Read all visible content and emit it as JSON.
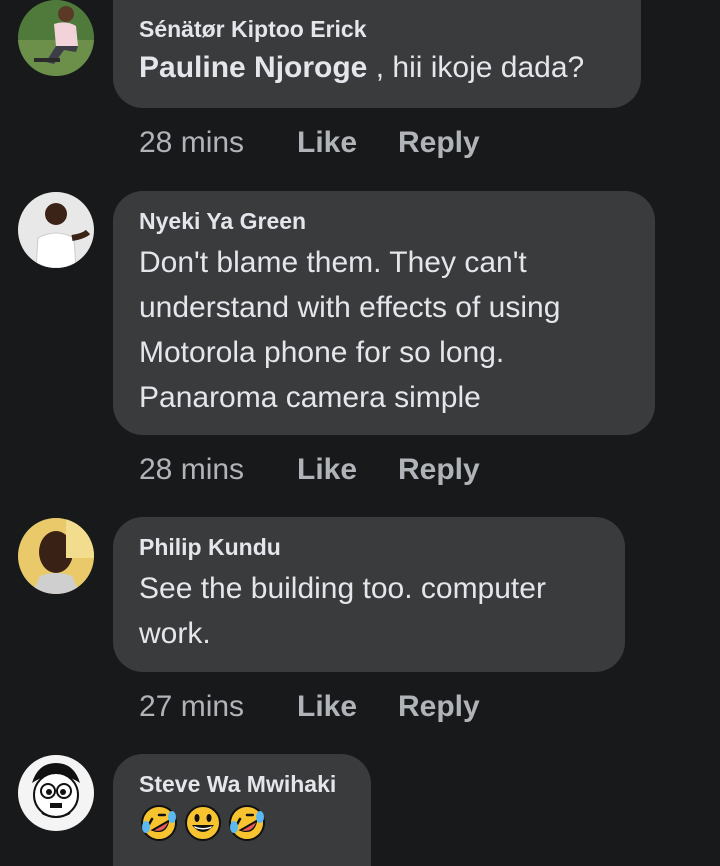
{
  "comments": [
    {
      "author": "Sénätør Kiptoo Erick",
      "mention": "Pauline Njoroge",
      "text": " , hii ikoje dada?",
      "time": "28 mins",
      "like": "Like",
      "reply": "Reply"
    },
    {
      "author": "Nyeki Ya Green",
      "text_lines": [
        "Don't blame them. They can't",
        "understand with effects of using",
        "Motorola phone for so long.",
        "Panaroma camera simple"
      ],
      "time": "28 mins",
      "like": "Like",
      "reply": "Reply"
    },
    {
      "author": "Philip Kundu",
      "text_lines": [
        "See the building too. computer",
        "work."
      ],
      "time": "27 mins",
      "like": "Like",
      "reply": "Reply"
    },
    {
      "author": "Steve Wa Mwihaki",
      "emojis": [
        "rolling-laughing-emoji",
        "grinning-emoji",
        "rolling-laughing-emoji"
      ]
    }
  ],
  "colors": {
    "background": "#18191a",
    "bubble": "#3a3b3c",
    "primary_text": "#e4e6eb",
    "secondary_text": "#b0b3b8",
    "emoji_yellow": "#f7c42f"
  }
}
